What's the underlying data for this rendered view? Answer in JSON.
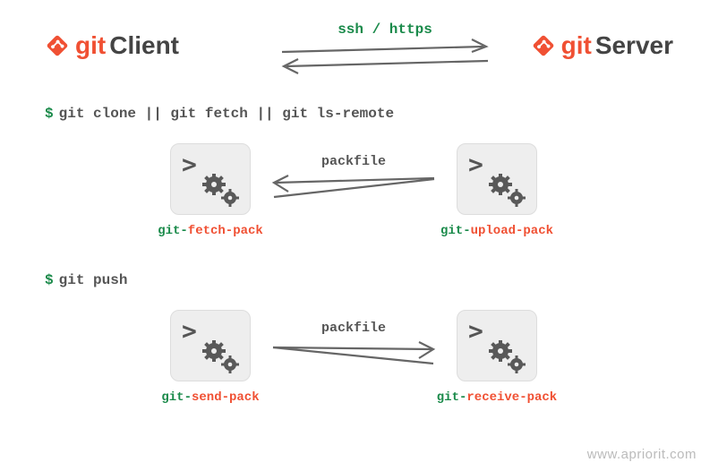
{
  "header": {
    "protocol_label": "ssh / https",
    "git_word": "git",
    "client_role": "Client",
    "server_role": "Server"
  },
  "commands": {
    "fetch_line": "git clone || git fetch || git ls-remote",
    "push_line": "git push",
    "prompt": "$"
  },
  "row_fetch": {
    "left_box_prefix": "git-",
    "left_box_accent": "fetch-pack",
    "right_box_prefix": "git-",
    "right_box_accent": "upload-pack",
    "arrow_label": "packfile"
  },
  "row_push": {
    "left_box_prefix": "git-",
    "left_box_accent": "send-pack",
    "right_box_prefix": "git-",
    "right_box_accent": "receive-pack",
    "arrow_label": "packfile"
  },
  "icons": {
    "chevron": ">"
  },
  "watermark": "www.apriorit.com"
}
